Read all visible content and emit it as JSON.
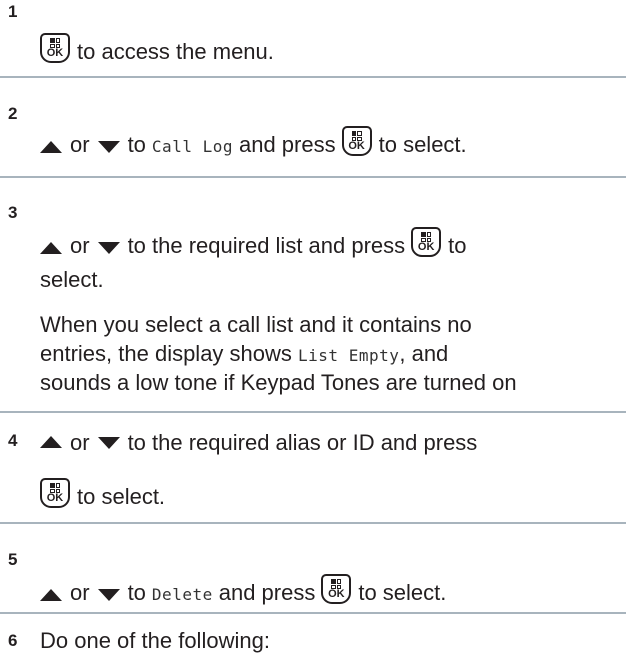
{
  "steps": [
    {
      "num": "1",
      "text_after_ok": "to access the menu."
    },
    {
      "num": "2",
      "or": "or",
      "to": "to",
      "target": "Call Log",
      "and_press": "and press",
      "to_select": "to select."
    },
    {
      "num": "3",
      "or": "or",
      "to_text": "to the required list and press",
      "to": "to",
      "select": "select.",
      "note_1": "When you select a call list and it contains no",
      "note_2_a": "entries, the display shows",
      "note_2_mono": "List Empty",
      "note_2_b": ", and",
      "note_3": "sounds a low tone if Keypad Tones are turned on"
    },
    {
      "num": "4",
      "or": "or",
      "to_text": "to the required alias or ID and press",
      "to_select": "to select."
    },
    {
      "num": "5",
      "or": "or",
      "to": "to",
      "target": "Delete",
      "and_press": "and press",
      "to_select": "to select."
    },
    {
      "num": "6",
      "text": "Do one of the following:"
    }
  ],
  "icons": {
    "ok_button_label": "OK",
    "up": "up-arrow-icon",
    "down": "down-arrow-icon",
    "ok": "menu-ok-button-icon"
  },
  "colors": {
    "text": "#231f20",
    "separator": "#a8b4bd"
  }
}
